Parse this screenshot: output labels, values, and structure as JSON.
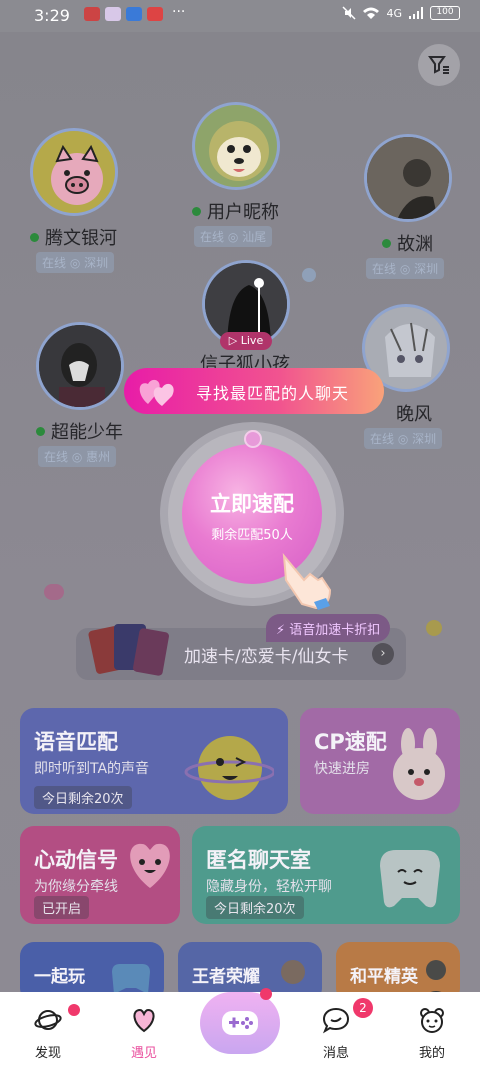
{
  "status_bar": {
    "time": "3:29",
    "dots": "···",
    "network": "4G",
    "battery": "100"
  },
  "users": [
    {
      "name": "腾文银河",
      "status": "在线",
      "city": "深圳",
      "avatar_icon": "pig-avatar-icon"
    },
    {
      "name": "用户昵称",
      "status": "在线",
      "city": "汕尾",
      "avatar_icon": "dog-avatar-icon"
    },
    {
      "name": "故渊",
      "status": "在线",
      "city": "深圳",
      "avatar_icon": "person-avatar-icon"
    },
    {
      "name": "信子狐小孩",
      "live": "Live",
      "avatar_icon": "hood-avatar-icon"
    },
    {
      "name": "超能少年",
      "status": "在线",
      "city": "惠州",
      "avatar_icon": "mask-avatar-icon"
    },
    {
      "name": "晚风",
      "status": "在线",
      "city": "深圳",
      "avatar_icon": "anime-avatar-icon"
    }
  ],
  "banner": {
    "text": "寻找最匹配的人聊天"
  },
  "match": {
    "title": "立即速配",
    "subtitle": "剩余匹配50人"
  },
  "speed": {
    "tag": "语音加速卡折扣",
    "text": "加速卡/恋爱卡/仙女卡"
  },
  "tiles": [
    {
      "title": "语音匹配",
      "sub": "即时听到TA的声音",
      "badge": "今日剩余20次",
      "color": "#5d67ad"
    },
    {
      "title": "CP速配",
      "sub": "快速进房",
      "badge": "",
      "color": "#a26aa6"
    },
    {
      "title": "心动信号",
      "sub": "为你缘分牵线",
      "badge": "已开启",
      "color": "#b34e83"
    },
    {
      "title": "匿名聊天室",
      "sub": "隐藏身份，轻松开聊",
      "badge": "今日剩余20次",
      "color": "#4f9b8d"
    },
    {
      "title": "一起玩",
      "color": "#4a5fa8"
    },
    {
      "title": "王者荣耀",
      "color": "#5566a6"
    },
    {
      "title": "和平精英",
      "color": "#b87a46"
    }
  ],
  "tabs": [
    {
      "label": "发现",
      "icon": "planet-icon"
    },
    {
      "label": "遇见",
      "icon": "heart-icon"
    },
    {
      "label": "",
      "icon": "gamepad-icon"
    },
    {
      "label": "消息",
      "icon": "chat-icon",
      "badge": "2"
    },
    {
      "label": "我的",
      "icon": "bear-icon"
    }
  ],
  "colors": {
    "accent": "#ea4f9e",
    "banner_start": "#e81ca8",
    "banner_end": "#f9a27a",
    "badge": "#f0386b"
  }
}
